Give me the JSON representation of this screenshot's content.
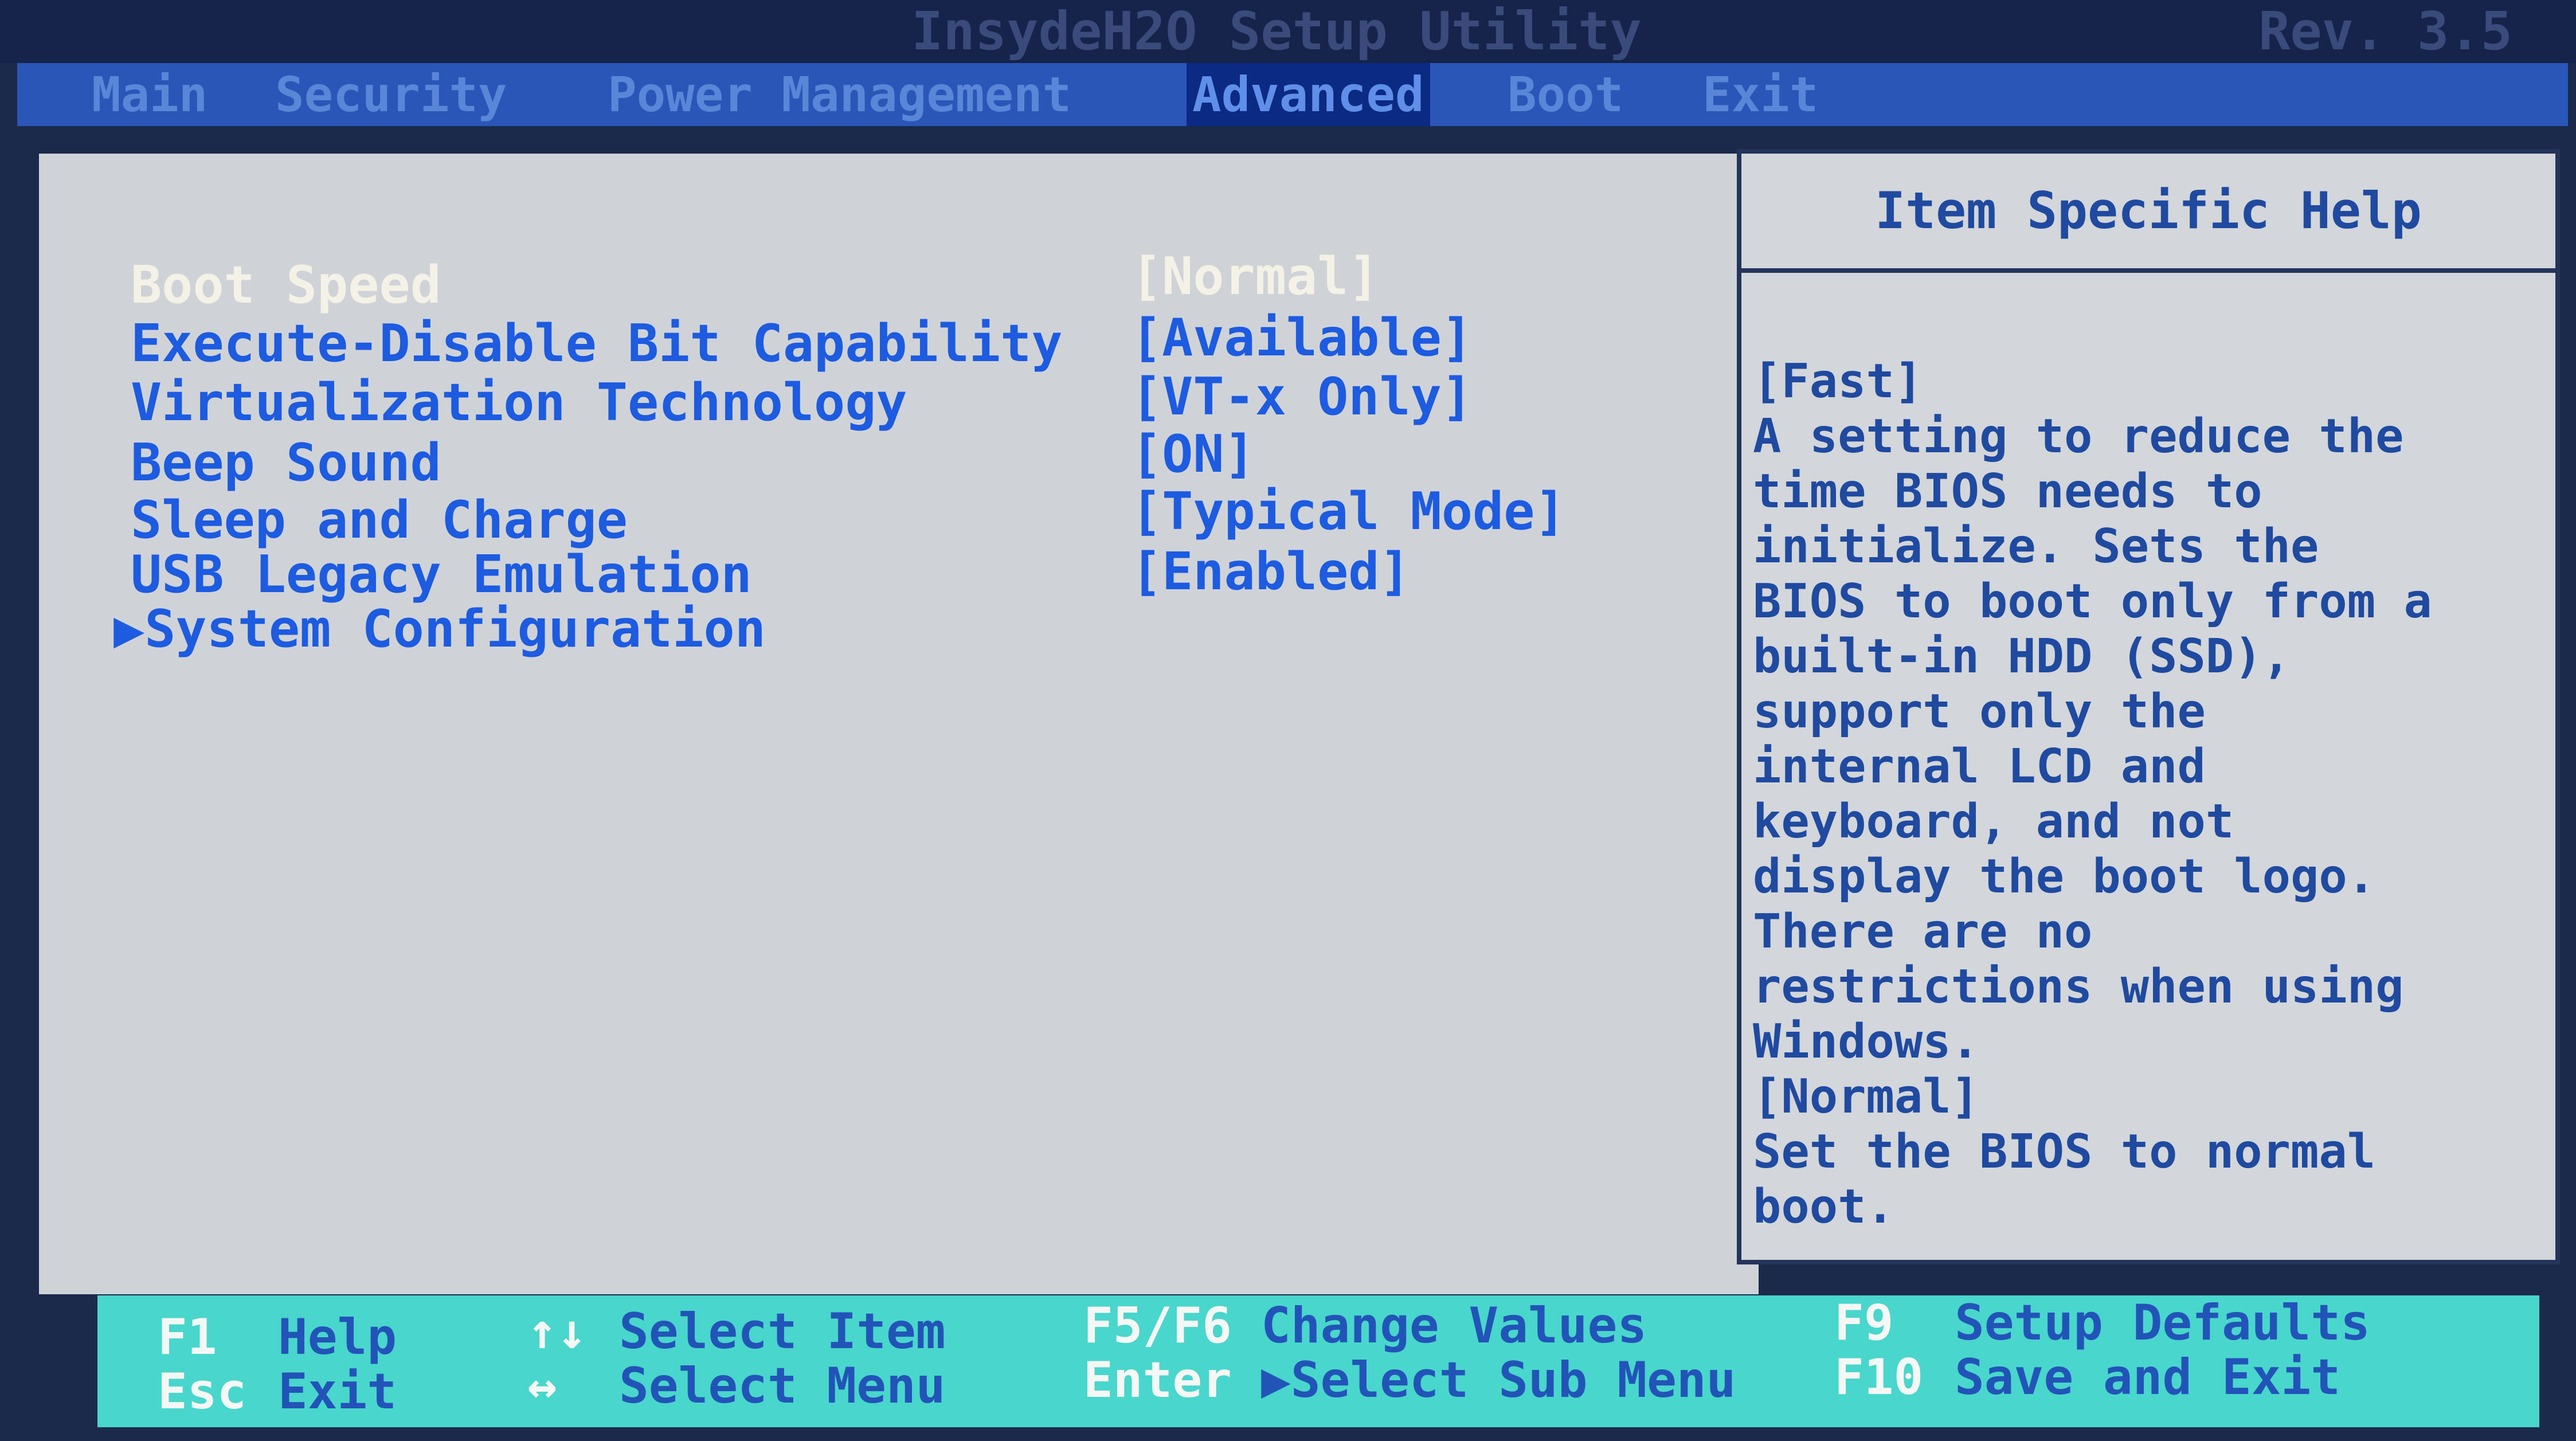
{
  "title_bar": {
    "title": "InsydeH2O Setup Utility",
    "revision": "Rev. 3.5"
  },
  "menu": {
    "tabs": [
      {
        "label": "Main",
        "active": false
      },
      {
        "label": "Security",
        "active": false
      },
      {
        "label": "Power Management",
        "active": false
      },
      {
        "label": "Advanced",
        "active": true
      },
      {
        "label": "Boot",
        "active": false
      },
      {
        "label": "Exit",
        "active": false
      }
    ]
  },
  "settings": [
    {
      "label": "Boot Speed",
      "value": "[Normal]",
      "selected": true
    },
    {
      "label": "Execute-Disable Bit Capability",
      "value": "[Available]",
      "selected": false
    },
    {
      "label": "Virtualization Technology",
      "value": "[VT-x Only]",
      "selected": false
    },
    {
      "label": "Beep Sound",
      "value": "[ON]",
      "selected": false
    },
    {
      "label": "Sleep and Charge",
      "value": "[Typical Mode]",
      "selected": false
    },
    {
      "label": "USB Legacy Emulation",
      "value": "[Enabled]",
      "selected": false
    },
    {
      "label": "System Configuration",
      "submenu": true
    }
  ],
  "submenu_marker": "▶",
  "help": {
    "header": "Item Specific Help",
    "lines": [
      "[Fast]",
      "A setting to reduce the",
      "time BIOS needs to",
      "initialize. Sets the",
      "BIOS to boot only from a",
      "built-in HDD (SSD),",
      "support only the",
      "internal LCD and",
      "keyboard, and not",
      "display the boot logo.",
      "There are no",
      "restrictions when using",
      "Windows.",
      "[Normal]",
      "Set the BIOS to normal",
      "boot."
    ]
  },
  "footer": {
    "f1_key": "F1",
    "f1_desc": "Help",
    "esc_key": "Esc",
    "esc_desc": "Exit",
    "updown_key": "↑↓",
    "updown_desc": "Select Item",
    "leftright_key": "↔",
    "leftright_desc": "Select Menu",
    "f5f6_key": "F5/F6",
    "f5f6_desc": "Change Values",
    "enter_key": "Enter",
    "enter_desc": "▶Select Sub Menu",
    "f9_key": "F9",
    "f9_desc": "Setup Defaults",
    "f10_key": "F10",
    "f10_desc": "Save and Exit"
  },
  "colors": {
    "selected_text": "#f4f1e6",
    "item_text": "#1d5be0",
    "panel_bg": "#cfd3d8",
    "footer_bg": "#49d6cc",
    "menu_bg": "#2a56b8",
    "active_tab_bg": "#0b2a84"
  }
}
